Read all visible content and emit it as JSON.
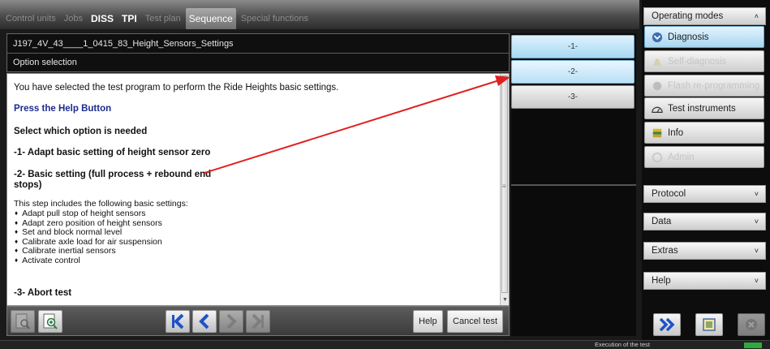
{
  "tabs": [
    {
      "label": "Control units",
      "style": "dim"
    },
    {
      "label": "Jobs",
      "style": "dim"
    },
    {
      "label": "DISS",
      "style": "bold"
    },
    {
      "label": "TPI",
      "style": "bold"
    },
    {
      "label": "Test plan",
      "style": "dim"
    },
    {
      "label": "Sequence",
      "style": "active"
    },
    {
      "label": "Special functions",
      "style": "dim"
    }
  ],
  "header": {
    "program": "J197_4V_43____1_0415_83_Height_Sensors_Settings",
    "subtitle": "Option selection"
  },
  "content": {
    "intro": "You have selected the test program to perform the Ride Heights basic settings.",
    "help_hint": "Press the Help Button",
    "select_prompt": "Select which option is needed",
    "option1": "-1- Adapt basic setting of height sensor zero",
    "option2_line1": "-2- Basic setting (full process + rebound end",
    "option2_line2": "stops)",
    "step_intro": "This step includes the following basic settings:",
    "steps": [
      "Adapt pull stop of height sensors",
      "Adapt zero position of height sensors",
      "Set and block normal level",
      "Calibrate axle load for air suspension",
      "Calibrate inertial sensors",
      "Activate control"
    ],
    "option3": "-3- Abort test"
  },
  "toolbar": {
    "help_label": "Help",
    "cancel_label": "Cancel test"
  },
  "options": [
    "-1-",
    "-2-",
    "-3-"
  ],
  "sidebar": {
    "title": "Operating modes",
    "modes": [
      {
        "label": "Diagnosis",
        "state": "active",
        "icon": "diagnosis-icon"
      },
      {
        "label": "Self-diagnosis",
        "state": "disabled",
        "icon": "self-diagnosis-icon"
      },
      {
        "label": "Flash re-programming",
        "state": "disabled",
        "icon": "flash-icon"
      },
      {
        "label": "Test instruments",
        "state": "normal",
        "icon": "gauge-icon"
      },
      {
        "label": "Info",
        "state": "normal",
        "icon": "info-book-icon"
      },
      {
        "label": "Admin",
        "state": "disabled",
        "icon": "admin-icon"
      }
    ],
    "sections": [
      "Protocol",
      "Data",
      "Extras",
      "Help"
    ]
  },
  "status": {
    "text": "Execution of the test",
    "progress": 1.0
  },
  "colors": {
    "accent_blue": "#a8d6ef",
    "annotation_red": "#e02020",
    "progress_green": "#2cab3c",
    "help_text_blue": "#1c2c8c"
  }
}
